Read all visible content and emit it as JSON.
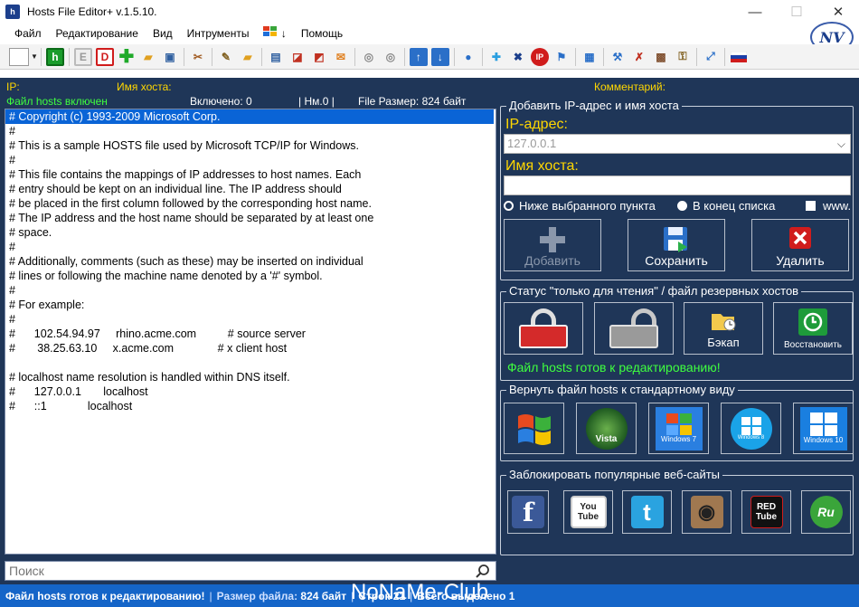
{
  "window": {
    "title": "Hosts File Editor+ v.1.5.10.",
    "icon_text": "h",
    "minimize": "—",
    "maximize": "☐",
    "close": "✕"
  },
  "menu": {
    "file": "Файл",
    "edit": "Редактирование",
    "view": "Вид",
    "tools": "Интрументы",
    "windows_arrow": "↓",
    "help": "Помощь"
  },
  "logo": {
    "text": "NV"
  },
  "toolbar": {
    "h": "h",
    "e": "E",
    "d": "D",
    "ip": "IP"
  },
  "headers": {
    "ip": "IP:",
    "hostname": "Имя хоста:",
    "comment": "Комментарий:",
    "file_state": "Файл hosts включен",
    "enabled": "Включено: 0",
    "nm": "| Нм.0 |",
    "file_size": "File Размер: 824 байт"
  },
  "editor": {
    "lines": [
      "# Copyright (c) 1993-2009 Microsoft Corp.",
      "#",
      "# This is a sample HOSTS file used by Microsoft TCP/IP for Windows.",
      "#",
      "# This file contains the mappings of IP addresses to host names. Each",
      "# entry should be kept on an individual line. The IP address should",
      "# be placed in the first column followed by the corresponding host name.",
      "# The IP address and the host name should be separated by at least one",
      "# space.",
      "#",
      "# Additionally, comments (such as these) may be inserted on individual",
      "# lines or following the machine name denoted by a '#' symbol.",
      "#",
      "# For example:",
      "#",
      "#      102.54.94.97     rhino.acme.com          # source server",
      "#       38.25.63.10     x.acme.com              # x client host",
      "",
      "# localhost name resolution is handled within DNS itself.",
      "#\t127.0.0.1       localhost",
      "#\t::1             localhost"
    ]
  },
  "search": {
    "placeholder": "Поиск"
  },
  "add_group": {
    "title": "Добавить IP-адрес и имя хоста",
    "ip_label": "IP-адрес:",
    "ip_value": "127.0.0.1",
    "host_label": "Имя хоста:",
    "host_value": "",
    "radio_below": "Ниже выбранного пункта",
    "radio_end": "В конец списка",
    "www": "www.",
    "add": "Добавить",
    "save": "Сохранить",
    "delete": "Удалить"
  },
  "status_group": {
    "title": "Статус \"только для чтения\" / файл резервных хостов",
    "backup": "Бэкап",
    "restore": "Восстановить",
    "ready": "Файл hosts готов к редактированию!"
  },
  "restore_group": {
    "title": "Вернуть файл hosts к стандартному виду",
    "os": [
      "XP",
      "Vista",
      "Windows 7",
      "Windows 8",
      "Windows 10"
    ]
  },
  "block_group": {
    "title": "Заблокировать популярные веб-сайты",
    "sites": [
      "f",
      "You Tube",
      "t",
      "◉",
      "RED Tube",
      "Ru"
    ]
  },
  "statusbar": {
    "ready": "Файл hosts готов к редактированию!",
    "size_label": "Размер файла:",
    "size_value": "824 байт",
    "lines": "Строк 21",
    "selected": "Всего выделено 1"
  },
  "watermark": "NoNaMe-Club",
  "colors": {
    "panel": "#1f3658",
    "accent_yellow": "#ffd700",
    "ok_green": "#3fff3f",
    "status_blue": "#1565c8",
    "selection": "#0a64d6"
  }
}
